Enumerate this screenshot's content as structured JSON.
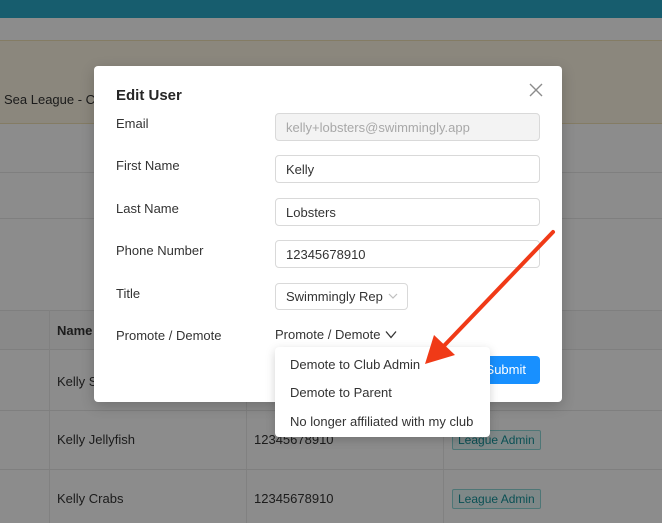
{
  "background": {
    "notice_text": "Sea League - Co",
    "table": {
      "header_name": "Name",
      "rows": [
        {
          "name": "Kelly S",
          "phone": "",
          "role": ""
        },
        {
          "name": "Kelly Jellyfish",
          "phone": "12345678910",
          "role": "League Admin"
        },
        {
          "name": "Kelly Crabs",
          "phone": "12345678910",
          "role": "League Admin"
        }
      ]
    }
  },
  "modal": {
    "title": "Edit User",
    "fields": {
      "email": {
        "label": "Email",
        "value": "kelly+lobsters@swimmingly.app"
      },
      "first_name": {
        "label": "First Name",
        "value": "Kelly"
      },
      "last_name": {
        "label": "Last Name",
        "value": "Lobsters"
      },
      "phone": {
        "label": "Phone Number",
        "value": "12345678910"
      },
      "title": {
        "label": "Title",
        "value": "Swimmingly Rep"
      },
      "promote": {
        "label": "Promote / Demote",
        "value": "Promote / Demote"
      }
    },
    "submit_label": "Submit"
  },
  "dropdown": {
    "items": [
      {
        "label": "Demote to Club Admin"
      },
      {
        "label": "Demote to Parent"
      },
      {
        "label": "No longer affiliated with my club"
      }
    ]
  },
  "annotation": {
    "color": "#f03a17"
  },
  "colors": {
    "primary": "#1890ff",
    "topbar": "#2aa9c8",
    "badge": "#15939a"
  }
}
